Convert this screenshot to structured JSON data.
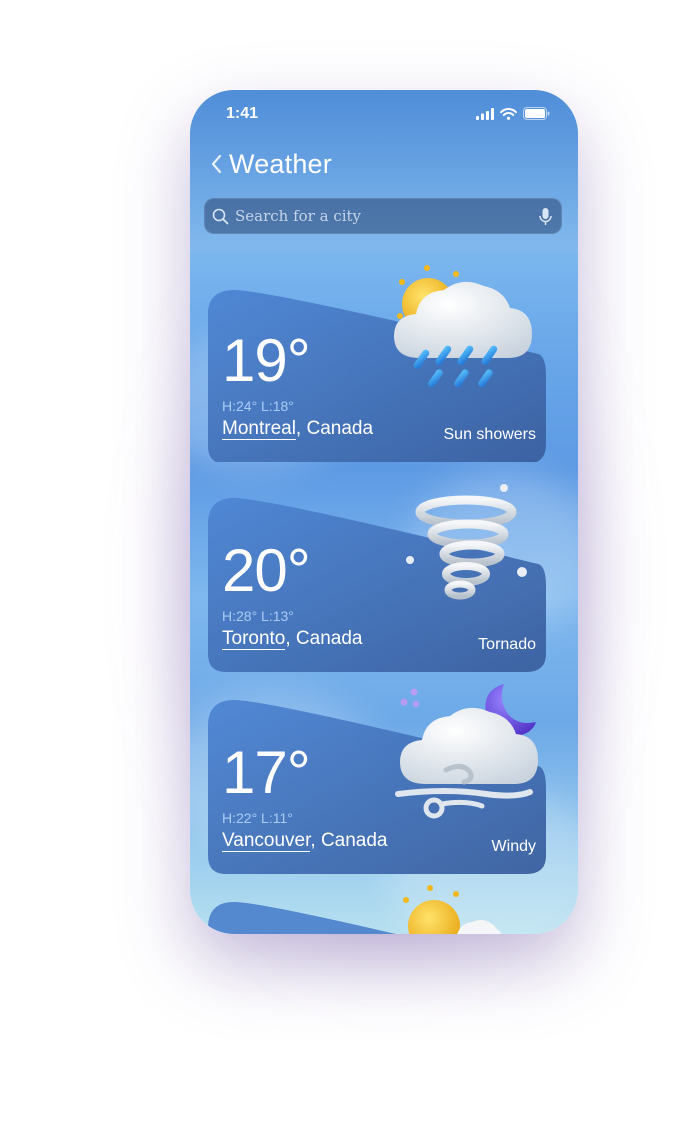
{
  "status_bar": {
    "time": "1:41"
  },
  "header": {
    "title": "Weather"
  },
  "search": {
    "placeholder": "Search for a city"
  },
  "cities": [
    {
      "temp": "19°",
      "high_low": "H:24° L:18°",
      "city": "Montreal",
      "country": ", Canada",
      "condition": "Sun showers",
      "icon": "sun-shower-icon"
    },
    {
      "temp": "20°",
      "high_low": "H:28° L:13°",
      "city": "Toronto",
      "country": ", Canada",
      "condition": "Tornado",
      "icon": "tornado-icon"
    },
    {
      "temp": "17°",
      "high_low": "H:22° L:11°",
      "city": "Vancouver",
      "country": ", Canada",
      "condition": "Windy",
      "icon": "windy-moon-icon"
    }
  ],
  "colors": {
    "card": "#3e6fb5",
    "accent": "#a9ccf5",
    "sun": "#f2b81e",
    "moon": "#6a4fd6"
  }
}
